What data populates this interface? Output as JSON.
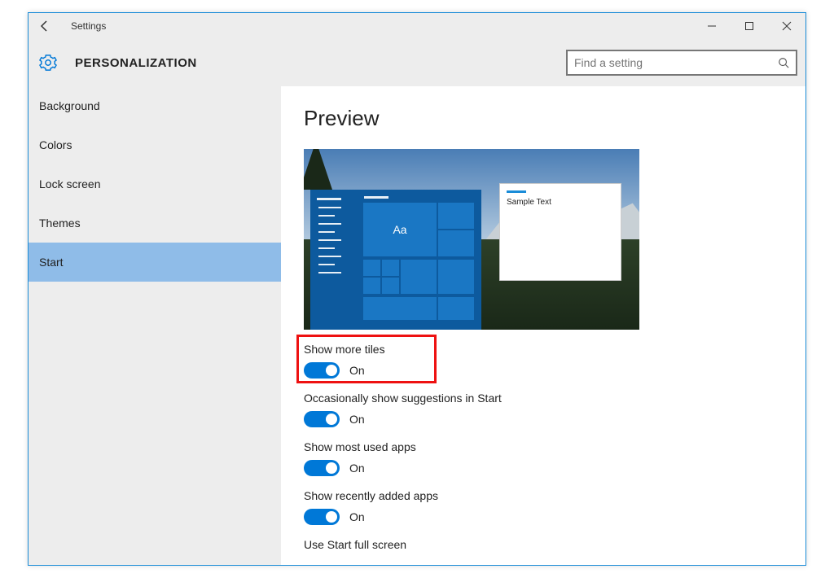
{
  "titlebar": {
    "title": "Settings"
  },
  "header": {
    "page_title": "PERSONALIZATION",
    "search_placeholder": "Find a setting"
  },
  "sidebar": {
    "items": [
      {
        "label": "Background",
        "selected": false
      },
      {
        "label": "Colors",
        "selected": false
      },
      {
        "label": "Lock screen",
        "selected": false
      },
      {
        "label": "Themes",
        "selected": false
      },
      {
        "label": "Start",
        "selected": true
      }
    ]
  },
  "content": {
    "preview_heading": "Preview",
    "preview_tile_text": "Aa",
    "preview_sample_text": "Sample Text",
    "settings": [
      {
        "label": "Show more tiles",
        "state": "On",
        "on": true,
        "highlighted": true
      },
      {
        "label": "Occasionally show suggestions in Start",
        "state": "On",
        "on": true
      },
      {
        "label": "Show most used apps",
        "state": "On",
        "on": true
      },
      {
        "label": "Show recently added apps",
        "state": "On",
        "on": true
      },
      {
        "label": "Use Start full screen",
        "state": "",
        "on": false
      }
    ]
  }
}
